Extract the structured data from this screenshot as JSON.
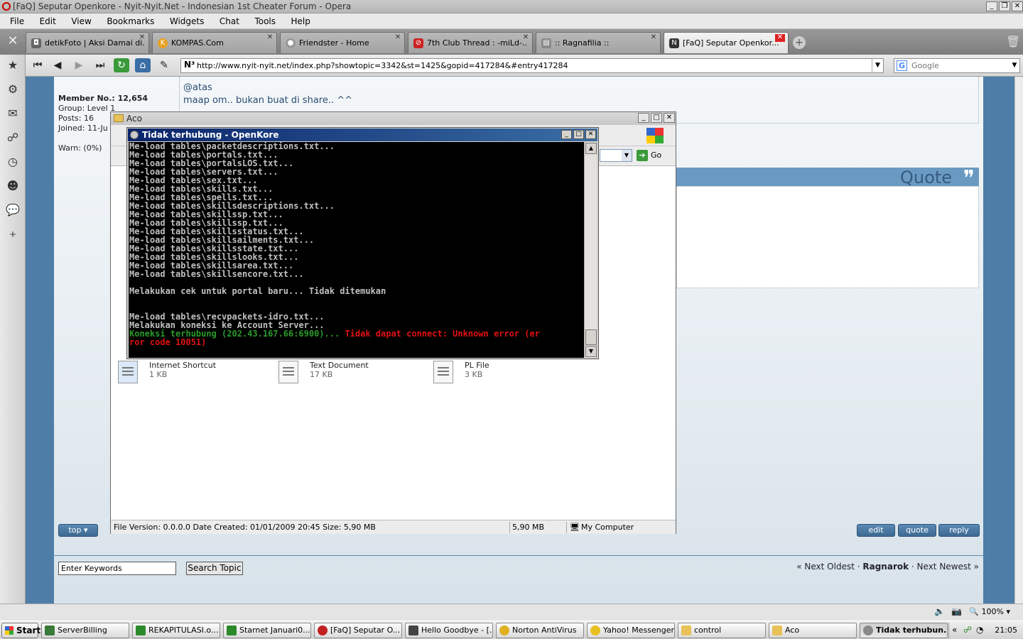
{
  "window_title": "[FaQ] Seputar Openkore - Nyit-Nyit.Net - Indonesian 1st Cheater Forum - Opera",
  "menu": [
    "File",
    "Edit",
    "View",
    "Bookmarks",
    "Widgets",
    "Chat",
    "Tools",
    "Help"
  ],
  "tabs": [
    {
      "label": "detikFoto | Aksi Damai di...",
      "icon": "camera-icon",
      "color": "#666666"
    },
    {
      "label": "KOMPAS.Com",
      "icon": "kompas-icon",
      "color": "#e8a020"
    },
    {
      "label": "Friendster - Home",
      "icon": "friendster-icon",
      "color": "#999999"
    },
    {
      "label": "7th Club Thread : -miLd-...",
      "icon": "forum-icon",
      "color": "#cc2222"
    },
    {
      "label": ":: Ragnafilia ::",
      "icon": "page-icon",
      "color": "#888888"
    },
    {
      "label": "[FaQ] Seputar Openkor...",
      "icon": "nyit-icon",
      "color": "#333333"
    }
  ],
  "address": {
    "url": "http://www.nyit-nyit.net/index.php?showtopic=3342&st=1425&gopid=417284&#entry417284",
    "search_placeholder": "Google"
  },
  "profile": {
    "member_no": "Member No.: 12,654",
    "group": "Group: Level 1",
    "posts": "Posts: 16",
    "joined": "Joined: 11-Ju",
    "warn": "Warn: (0%)"
  },
  "post": {
    "line1": "@atas",
    "line2": "maap om.. bukan buat di share.. ^^"
  },
  "quote_label": "Quote",
  "buttons": {
    "top": "top",
    "edit": "edit",
    "quote": "quote",
    "reply": "reply"
  },
  "search": {
    "placeholder": "Enter Keywords",
    "button": "Search Topic"
  },
  "nav": {
    "prev": "« Next Oldest",
    "sep": " · ",
    "cat": "Ragnarok",
    "next": "Next Newest »"
  },
  "explorer": {
    "title": "Aco",
    "go": "Go",
    "files": [
      {
        "name": "Internet Shortcut",
        "size": "1 KB"
      },
      {
        "name": "Text Document",
        "size": "17 KB"
      },
      {
        "name": "PL File",
        "size": "3 KB"
      }
    ],
    "status_info": "File Version: 0.0.0.0 Date Created: 01/01/2009 20:45 Size: 5,90 MB",
    "status_size": "5,90 MB",
    "status_zone": "My Computer"
  },
  "console": {
    "title": "Tidak terhubung - OpenKore",
    "lines": [
      "Me-load tables\\packetdescriptions.txt...",
      "Me-load tables\\portals.txt...",
      "Me-load tables\\portalsLOS.txt...",
      "Me-load tables\\servers.txt...",
      "Me-load tables\\sex.txt...",
      "Me-load tables\\skills.txt...",
      "Me-load tables\\spells.txt...",
      "Me-load tables\\skillsdescriptions.txt...",
      "Me-load tables\\skillssp.txt...",
      "Me-load tables\\skillssp.txt...",
      "Me-load tables\\skillsstatus.txt...",
      "Me-load tables\\skillsailments.txt...",
      "Me-load tables\\skillsstate.txt...",
      "Me-load tables\\skillslooks.txt...",
      "Me-load tables\\skillsarea.txt...",
      "Me-load tables\\skillsencore.txt...",
      "",
      "Melakukan cek untuk portal baru... Tidak ditemukan",
      "",
      "",
      "Me-load tables\\recvpackets-idro.txt...",
      "Melakukan koneksi ke Account Server..."
    ],
    "connect_green": "Koneksi terhubung (202.43.167.66:6900)... ",
    "connect_red_1": "Tidak dapat connect: Unknown error (er",
    "connect_red_2": "ror code 10051)"
  },
  "status_zoom": "100%",
  "taskbar": {
    "start": "Start",
    "items": [
      {
        "label": "ServerBilling",
        "color": "#3a7a3a"
      },
      {
        "label": "REKAPITULASI.o...",
        "color": "#2a8a2a"
      },
      {
        "label": "Starnet Januari0...",
        "color": "#2a8a2a"
      },
      {
        "label": "[FaQ] Seputar O...",
        "color": "#c02020"
      },
      {
        "label": "Hello Goodbye - [...",
        "color": "#444444"
      },
      {
        "label": "Norton AntiVirus",
        "color": "#e0b020"
      },
      {
        "label": "Yahoo! Messenger",
        "color": "#e8c020"
      },
      {
        "label": "control",
        "color": "#e8c259"
      },
      {
        "label": "Aco",
        "color": "#e8c259"
      },
      {
        "label": "Tidak terhubun...",
        "color": "#888888"
      }
    ],
    "clock": "21:05"
  }
}
